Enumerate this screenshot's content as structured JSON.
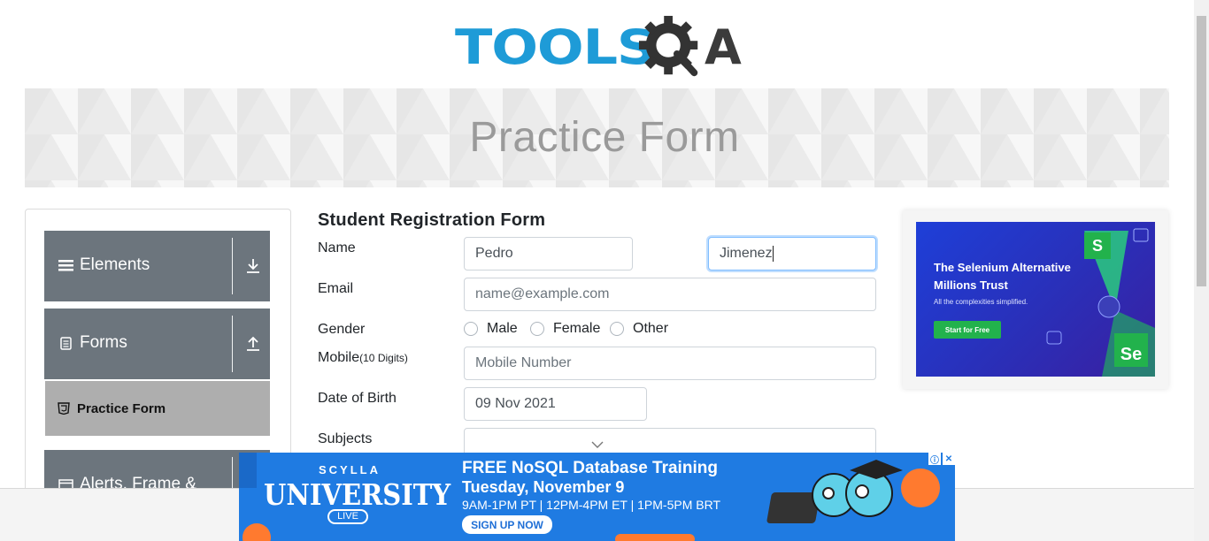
{
  "logo": {
    "text_left": "TOOLS",
    "text_right": "A"
  },
  "banner": {
    "title": "Practice Form"
  },
  "nav": {
    "groups": [
      {
        "label": "Elements",
        "icon": "bars-icon",
        "arrow": "download-arrow-icon"
      },
      {
        "label": "Forms",
        "icon": "document-icon",
        "arrow": "upload-arrow-icon"
      },
      {
        "label": "Alerts, Frame &",
        "icon": "window-icon"
      }
    ],
    "active_item": {
      "label": "Practice Form",
      "icon": "html5-icon"
    }
  },
  "form": {
    "title": "Student Registration Form",
    "name_label": "Name",
    "first_name_value": "Pedro",
    "last_name_value": "Jimenez",
    "email_label": "Email",
    "email_placeholder": "name@example.com",
    "gender_label": "Gender",
    "gender_options": [
      "Male",
      "Female",
      "Other"
    ],
    "mobile_label": "Mobile",
    "mobile_hint": "(10 Digits)",
    "mobile_placeholder": "Mobile Number",
    "dob_label": "Date of Birth",
    "dob_value": "09 Nov 2021",
    "subjects_label": "Subjects"
  },
  "side_ad": {
    "headline_1": "The Selenium Alternative",
    "headline_2": "Millions Trust",
    "subtext": "All the complexities simplified.",
    "button": "Start for Free",
    "badge_s": "S",
    "badge_se": "Se"
  },
  "bottom_ad": {
    "brand_top": "SCYLLA",
    "brand_main": "UNIVERSITY",
    "brand_tag": "LIVE",
    "headline": "FREE NoSQL Database Training",
    "date": "Tuesday, November 9",
    "times": "9AM-1PM PT | 12PM-4PM ET | 1PM-5PM BRT",
    "cta": "SIGN UP NOW",
    "info_icon": "ⓘ",
    "close_icon": "✕"
  }
}
